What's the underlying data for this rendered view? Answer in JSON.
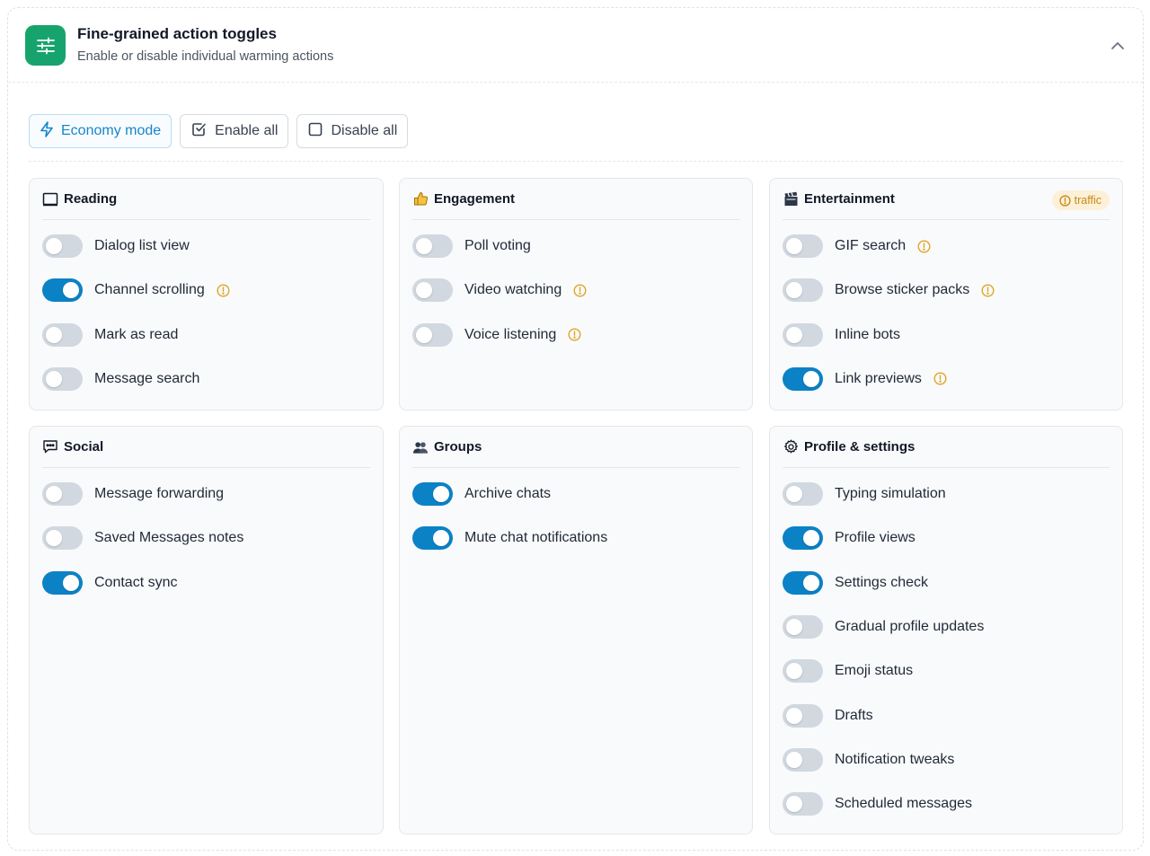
{
  "header": {
    "title": "Fine-grained action toggles",
    "subtitle": "Enable or disable individual warming actions",
    "icon": "sliders-icon",
    "collapse_icon": "chevron-up-icon"
  },
  "toolbar": {
    "economy_label": "Economy mode",
    "enable_all_label": "Enable all",
    "disable_all_label": "Disable all"
  },
  "colors": {
    "accent": "#0c82c6",
    "brand": "#16a46c",
    "warning": "#e0a526",
    "toggle_off": "#d1d8e0"
  },
  "categories": [
    {
      "id": "reading",
      "title": "Reading",
      "icon": "book-icon",
      "items": [
        {
          "label": "Dialog list view",
          "on": false,
          "warn": false
        },
        {
          "label": "Channel scrolling",
          "on": true,
          "warn": true
        },
        {
          "label": "Mark as read",
          "on": false,
          "warn": false
        },
        {
          "label": "Message search",
          "on": false,
          "warn": false
        }
      ]
    },
    {
      "id": "engagement",
      "title": "Engagement",
      "icon": "thumbs-up-icon",
      "items": [
        {
          "label": "Poll voting",
          "on": false,
          "warn": false
        },
        {
          "label": "Video watching",
          "on": false,
          "warn": true
        },
        {
          "label": "Voice listening",
          "on": false,
          "warn": true
        }
      ]
    },
    {
      "id": "entertainment",
      "title": "Entertainment",
      "icon": "clapperboard-icon",
      "badge": "traffic",
      "items": [
        {
          "label": "GIF search",
          "on": false,
          "warn": true
        },
        {
          "label": "Browse sticker packs",
          "on": false,
          "warn": true
        },
        {
          "label": "Inline bots",
          "on": false,
          "warn": false
        },
        {
          "label": "Link previews",
          "on": true,
          "warn": true
        }
      ]
    },
    {
      "id": "social",
      "title": "Social",
      "icon": "chat-bubble-icon",
      "items": [
        {
          "label": "Message forwarding",
          "on": false,
          "warn": false
        },
        {
          "label": "Saved Messages notes",
          "on": false,
          "warn": false
        },
        {
          "label": "Contact sync",
          "on": true,
          "warn": false
        }
      ]
    },
    {
      "id": "groups",
      "title": "Groups",
      "icon": "people-icon",
      "items": [
        {
          "label": "Archive chats",
          "on": true,
          "warn": false
        },
        {
          "label": "Mute chat notifications",
          "on": true,
          "warn": false
        }
      ]
    },
    {
      "id": "profile",
      "title": "Profile & settings",
      "icon": "gear-icon",
      "items": [
        {
          "label": "Typing simulation",
          "on": false,
          "warn": false
        },
        {
          "label": "Profile views",
          "on": true,
          "warn": false
        },
        {
          "label": "Settings check",
          "on": true,
          "warn": false
        },
        {
          "label": "Gradual profile updates",
          "on": false,
          "warn": false
        },
        {
          "label": "Emoji status",
          "on": false,
          "warn": false
        },
        {
          "label": "Drafts",
          "on": false,
          "warn": false
        },
        {
          "label": "Notification tweaks",
          "on": false,
          "warn": false
        },
        {
          "label": "Scheduled messages",
          "on": false,
          "warn": false
        }
      ]
    }
  ]
}
